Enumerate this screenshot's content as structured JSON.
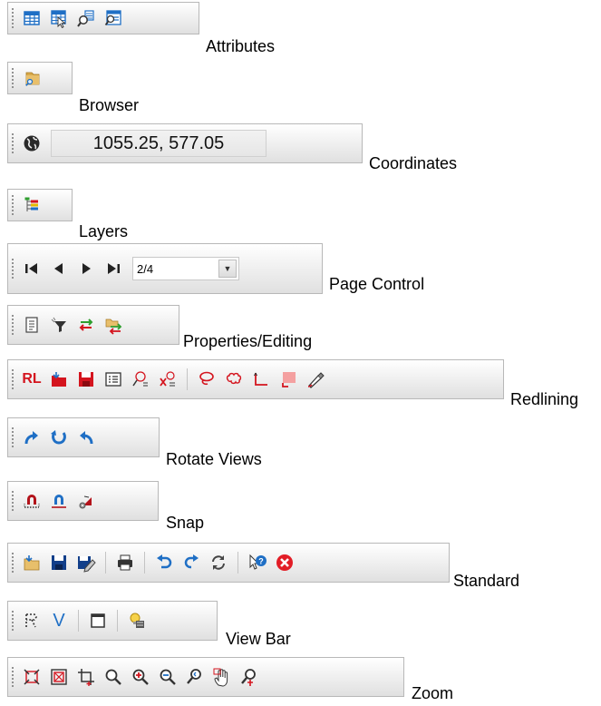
{
  "toolbars": [
    {
      "id": "attributes",
      "label": "Attributes"
    },
    {
      "id": "browser",
      "label": "Browser"
    },
    {
      "id": "coordinates",
      "label": "Coordinates",
      "value": "1055.25,  577.05"
    },
    {
      "id": "layers",
      "label": "Layers"
    },
    {
      "id": "page_control",
      "label": "Page Control",
      "page": "2/4"
    },
    {
      "id": "properties_editing",
      "label": "Properties/Editing"
    },
    {
      "id": "redlining",
      "label": "Redlining",
      "rl_text": "RL"
    },
    {
      "id": "rotate_views",
      "label": "Rotate Views"
    },
    {
      "id": "snap",
      "label": "Snap"
    },
    {
      "id": "standard",
      "label": "Standard"
    },
    {
      "id": "view_bar",
      "label": "View Bar",
      "v_text": "V"
    },
    {
      "id": "zoom",
      "label": "Zoom"
    }
  ],
  "colors": {
    "accent_blue": "#1f6fc5",
    "accent_red": "#d4141e",
    "accent_green": "#2e9e2e"
  }
}
